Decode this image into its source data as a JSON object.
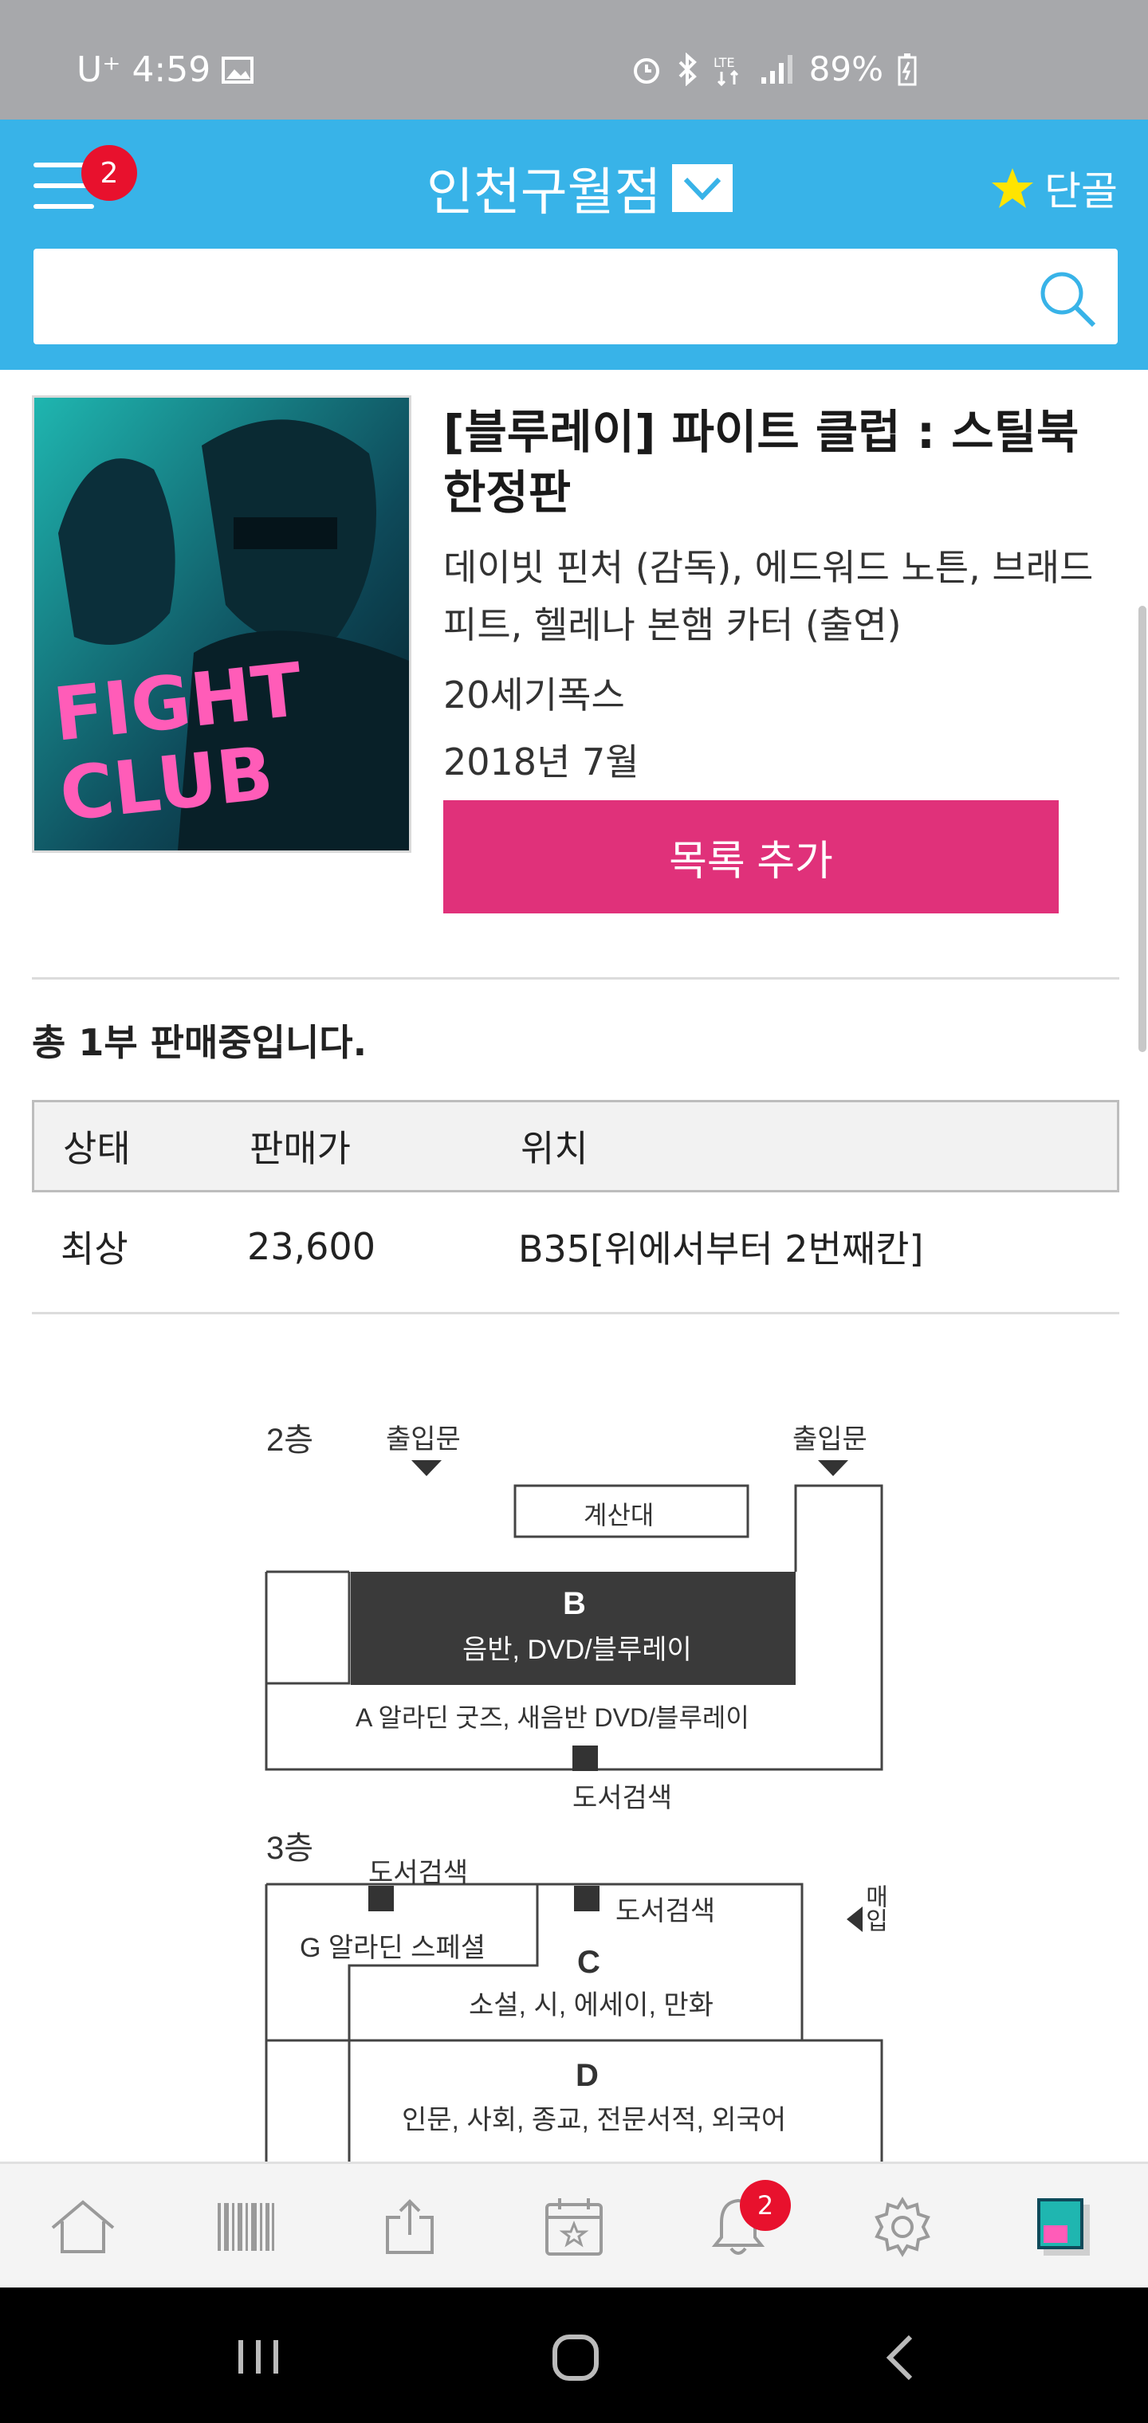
{
  "status_bar": {
    "carrier": "U⁺",
    "time": "4:59",
    "battery": "89%"
  },
  "header": {
    "menu_badge": "2",
    "store_name": "인천구월점",
    "favorite_label": "단골",
    "search_placeholder": ""
  },
  "product": {
    "title": "[블루레이] 파이트 클럽 : 스틸북 한정판",
    "credits": "데이빗 핀처 (감독), 에드워드 노튼, 브래드 피트, 헬레나 본햄 카터 (출연)",
    "publisher": "20세기폭스",
    "release": "2018년 7월",
    "add_button": "목록 추가",
    "cover_text_line1": "FIGHT",
    "cover_text_line2": "CLUB"
  },
  "sale_summary": "총 1부 판매중입니다.",
  "stock_table": {
    "headers": [
      "상태",
      "판매가",
      "위치"
    ],
    "rows": [
      [
        "최상",
        "23,600",
        "B35[위에서부터 2번째칸]"
      ]
    ]
  },
  "floor_map": {
    "floor2": "2층",
    "entrance_left": "출입문",
    "entrance_right": "출입문",
    "counter": "계산대",
    "zone_b_letter": "B",
    "zone_b_desc": "음반, DVD/블루레이",
    "zone_a": "A 알라딘 굿즈, 새음반 DVD/블루레이",
    "book_search_2f": "도서검색",
    "floor3": "3층",
    "book_search_3f_a": "도서검색",
    "book_search_3f_b": "도서검색",
    "zone_g": "G 알라딘 스페셜",
    "zone_c_letter": "C",
    "zone_c_desc": "소설, 시, 에세이, 만화",
    "zone_d_letter": "D",
    "zone_d_desc": "인문, 사회, 종교, 전문서적, 외국어",
    "side_label": "매입"
  },
  "bottom_nav": {
    "notification_badge": "2",
    "items": [
      "home-icon",
      "barcode-icon",
      "share-icon",
      "calendar-star-icon",
      "bell-icon",
      "gear-icon",
      "thumbnail-icon"
    ]
  },
  "colors": {
    "header_blue": "#38b3e8",
    "button_pink": "#e0317a",
    "badge_red": "#e8112d",
    "star_yellow": "#ffe400"
  }
}
